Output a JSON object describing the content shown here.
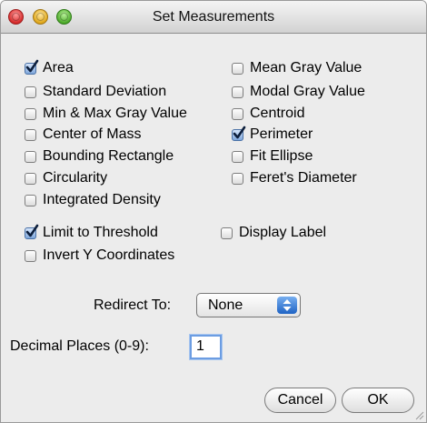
{
  "window": {
    "title": "Set Measurements"
  },
  "measurements": [
    {
      "label": "Area",
      "checked": true
    },
    {
      "label": "Mean Gray Value",
      "checked": false
    },
    {
      "label": "Standard Deviation",
      "checked": false
    },
    {
      "label": "Modal Gray Value",
      "checked": false
    },
    {
      "label": "Min & Max Gray Value",
      "checked": false
    },
    {
      "label": "Centroid",
      "checked": false
    },
    {
      "label": "Center of Mass",
      "checked": false
    },
    {
      "label": "Perimeter",
      "checked": true
    },
    {
      "label": "Bounding Rectangle",
      "checked": false
    },
    {
      "label": "Fit Ellipse",
      "checked": false
    },
    {
      "label": "Circularity",
      "checked": false
    },
    {
      "label": "Feret's Diameter",
      "checked": false
    },
    {
      "label": "Integrated Density",
      "checked": false
    }
  ],
  "options": [
    {
      "label": "Limit to Threshold",
      "checked": true
    },
    {
      "label": "Display Label",
      "checked": false
    },
    {
      "label": "Invert Y Coordinates",
      "checked": false
    }
  ],
  "redirect": {
    "label": "Redirect To:",
    "value": "None"
  },
  "decimal": {
    "label": "Decimal Places (0-9):",
    "value": "1"
  },
  "buttons": {
    "cancel": "Cancel",
    "ok": "OK"
  },
  "colors": {
    "check_accent": "#4a71a6",
    "focus_ring": "#6c9de2"
  }
}
